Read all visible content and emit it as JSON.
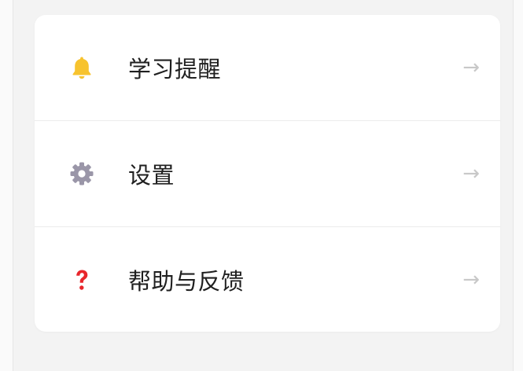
{
  "menu": {
    "items": [
      {
        "label": "学习提醒",
        "icon": "bell-icon",
        "icon_color": "#F7C32E",
        "arrow": "→"
      },
      {
        "label": "设置",
        "icon": "gear-icon",
        "icon_color": "#9A96A8",
        "arrow": "→"
      },
      {
        "label": "帮助与反馈",
        "icon": "question-mark-icon",
        "icon_color": "#E8262B",
        "arrow": "→"
      }
    ]
  },
  "colors": {
    "page_background": "#F3F3F3",
    "card_background": "#FFFFFF",
    "label_text": "#1F1F1F",
    "arrow": "#C8C8C8",
    "divider": "#ECECEC"
  }
}
